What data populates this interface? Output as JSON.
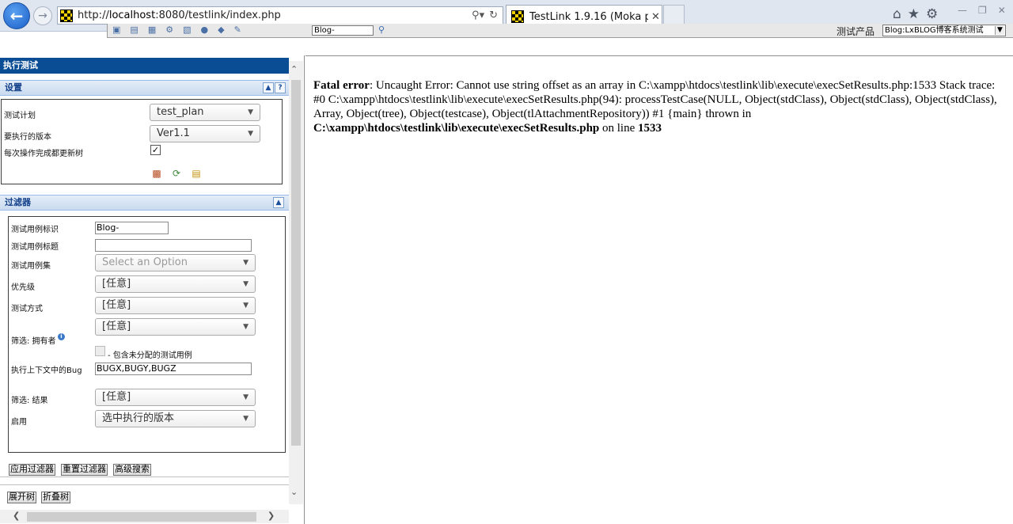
{
  "browser": {
    "url_prefix": "http://",
    "url_host": "localhost",
    "url_rest": ":8080/testlink/index.php",
    "tab_title": "TestLink 1.9.16 (Moka p...",
    "icons": {
      "back": "back-arrow-icon",
      "forward": "forward-arrow-icon",
      "search": "search-icon",
      "refresh": "refresh-icon",
      "home": "home-icon",
      "favorites": "star-icon",
      "settings": "gear-icon"
    }
  },
  "toolbar": {
    "search_value": "Blog-",
    "product_label": "测试产品",
    "product_value": "Blog:LxBLOG博客系统测试"
  },
  "left": {
    "frame_title": "执行测试",
    "settings": {
      "header": "设置",
      "test_plan_label": "测试计划",
      "test_plan_value": "test_plan",
      "build_label": "要执行的版本",
      "build_value": "Ver1.1",
      "update_tree_label": "每次操作完成都更新树",
      "update_tree_checked": true
    },
    "filters": {
      "header": "过滤器",
      "tc_id_label": "测试用例标识",
      "tc_id_value": "Blog-",
      "tc_title_label": "测试用例标题",
      "tc_title_value": "",
      "suite_label": "测试用例集",
      "suite_placeholder": "Select an Option",
      "priority_label": "优先级",
      "priority_value": "[任意]",
      "exec_type_label": "测试方式",
      "exec_type_value": "[任意]",
      "owner_value": "[任意]",
      "owner_label": "筛选: 拥有者",
      "include_unassigned_label": "- 包含未分配的测试用例",
      "bugs_label": "执行上下文中的Bug",
      "bugs_value": "BUGX,BUGY,BUGZ",
      "result_label": "筛选: 结果",
      "result_value": "[任意]",
      "enable_label": "启用",
      "enable_value": "选中执行的版本"
    },
    "buttons": {
      "apply_filter": "应用过滤器",
      "reset_filter": "重置过滤器",
      "advanced_search": "高级搜索",
      "expand_tree": "展开树",
      "collapse_tree": "折叠树"
    }
  },
  "error": {
    "prefix": "Fatal error",
    "message": ": Uncaught Error: Cannot use string offset as an array in C:\\xampp\\htdocs\\testlink\\lib\\execute\\execSetResults.php:1533 Stack trace: #0 C:\\xampp\\htdocs\\testlink\\lib\\execute\\execSetResults.php(94): processTestCase(NULL, Object(stdClass), Object(stdClass), Object(stdClass), Array, Object(tree), Object(testcase), Object(tlAttachmentRepository)) #1 {main} thrown in ",
    "file": "C:\\xampp\\htdocs\\testlink\\lib\\execute\\execSetResults.php",
    "on_line": " on line ",
    "line": "1533"
  }
}
